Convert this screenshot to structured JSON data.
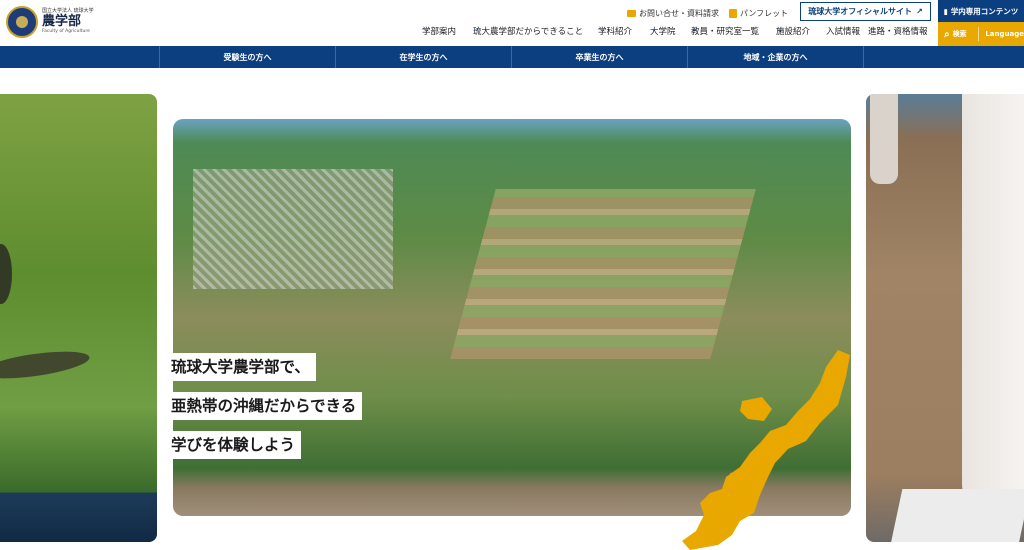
{
  "header": {
    "logo": {
      "subtitle": "国立大学法人 琉球大学",
      "title": "農学部",
      "english": "Faculty of Agriculture"
    },
    "utility": {
      "contact_label": "お問い合せ・資料請求",
      "pamphlet_label": "パンフレット",
      "official_site_label": "琉球大学オフィシャルサイト",
      "intranet_label": "学内専用コンテンツ",
      "search_label": "検索",
      "language_label": "Language"
    },
    "gnav": [
      {
        "label": "学部案内",
        "dropdown": true
      },
      {
        "label": "琉大農学部だからできること",
        "dropdown": true
      },
      {
        "label": "学科紹介",
        "dropdown": true
      },
      {
        "label": "大学院",
        "dropdown": true
      },
      {
        "label": "教員・研究室一覧",
        "dropdown": true
      },
      {
        "label": "施設紹介",
        "dropdown": true
      },
      {
        "label": "入試情報",
        "dropdown": false
      },
      {
        "label": "進路・資格情報",
        "dropdown": false
      }
    ]
  },
  "audience_bar": [
    "受験生の方へ",
    "在学生の方へ",
    "卒業生の方へ",
    "地域・企業の方へ"
  ],
  "hero": {
    "catch_lines": [
      "琉球大学農学部で、",
      "亜熱帯の沖縄だからできる",
      "学びを体験しよう"
    ]
  },
  "colors": {
    "brand_navy": "#0c3f7f",
    "accent_yellow": "#e8a800"
  },
  "icons": {
    "contact": "envelope-icon",
    "pamphlet": "book-icon",
    "external": "external-link-icon",
    "intranet": "document-icon",
    "search": "search-icon"
  }
}
